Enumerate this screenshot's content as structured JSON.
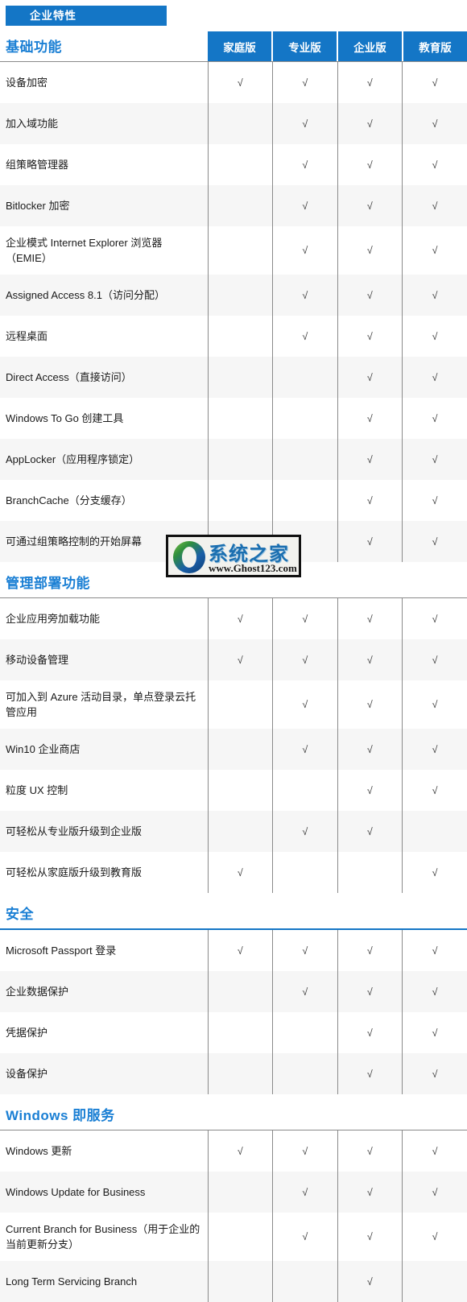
{
  "tab": {
    "label": "企业特性"
  },
  "columns": [
    "家庭版",
    "专业版",
    "企业版",
    "教育版"
  ],
  "check_glyph": "√",
  "colors": {
    "brand_blue": "#1476c6",
    "section_blue": "#1a7fd4",
    "rule_gray": "#8a8a8a",
    "alt_row": "#f6f6f6"
  },
  "watermark": {
    "name": "系统之家",
    "url": "www.Ghost123.com"
  },
  "sections": [
    {
      "title": "基础功能",
      "has_column_header": true,
      "rows": [
        {
          "name": "设备加密",
          "marks": [
            true,
            true,
            true,
            true
          ]
        },
        {
          "name": "加入域功能",
          "marks": [
            false,
            true,
            true,
            true
          ]
        },
        {
          "name": "组策略管理器",
          "marks": [
            false,
            true,
            true,
            true
          ]
        },
        {
          "name": "Bitlocker 加密",
          "marks": [
            false,
            true,
            true,
            true
          ]
        },
        {
          "name": "企业模式 Internet Explorer 浏览器（EMIE）",
          "marks": [
            false,
            true,
            true,
            true
          ],
          "tall": true
        },
        {
          "name": "Assigned Access 8.1（访问分配）",
          "marks": [
            false,
            true,
            true,
            true
          ]
        },
        {
          "name": "远程桌面",
          "marks": [
            false,
            true,
            true,
            true
          ]
        },
        {
          "name": "Direct Access（直接访问）",
          "marks": [
            false,
            false,
            true,
            true
          ]
        },
        {
          "name": "Windows To Go 创建工具",
          "marks": [
            false,
            false,
            true,
            true
          ]
        },
        {
          "name": "AppLocker（应用程序锁定）",
          "marks": [
            false,
            false,
            true,
            true
          ]
        },
        {
          "name": "BranchCache（分支缓存）",
          "marks": [
            false,
            false,
            true,
            true
          ]
        },
        {
          "name": "可通过组策略控制的开始屏幕",
          "marks": [
            false,
            false,
            true,
            true
          ]
        }
      ]
    },
    {
      "title": "管理部署功能",
      "has_column_header": false,
      "rows": [
        {
          "name": "企业应用旁加载功能",
          "marks": [
            true,
            true,
            true,
            true
          ]
        },
        {
          "name": "移动设备管理",
          "marks": [
            true,
            true,
            true,
            true
          ]
        },
        {
          "name": "可加入到 Azure 活动目录，单点登录云托管应用",
          "marks": [
            false,
            true,
            true,
            true
          ],
          "tall": true
        },
        {
          "name": "Win10 企业商店",
          "marks": [
            false,
            true,
            true,
            true
          ]
        },
        {
          "name": "粒度 UX 控制",
          "marks": [
            false,
            false,
            true,
            true
          ]
        },
        {
          "name": "可轻松从专业版升级到企业版",
          "marks": [
            false,
            true,
            true,
            false
          ]
        },
        {
          "name": "可轻松从家庭版升级到教育版",
          "marks": [
            true,
            false,
            false,
            true
          ]
        }
      ]
    },
    {
      "title": "安全",
      "has_column_header": false,
      "rows": [
        {
          "name": "Microsoft Passport 登录",
          "marks": [
            true,
            true,
            true,
            true
          ]
        },
        {
          "name": "企业数据保护",
          "marks": [
            false,
            true,
            true,
            true
          ]
        },
        {
          "name": "凭据保护",
          "marks": [
            false,
            false,
            true,
            true
          ]
        },
        {
          "name": "设备保护",
          "marks": [
            false,
            false,
            true,
            true
          ]
        }
      ]
    },
    {
      "title": "Windows 即服务",
      "has_column_header": false,
      "rows": [
        {
          "name": "Windows 更新",
          "marks": [
            true,
            true,
            true,
            true
          ]
        },
        {
          "name": "Windows Update for Business",
          "marks": [
            false,
            true,
            true,
            true
          ]
        },
        {
          "name": "Current Branch for Business（用于企业的当前更新分支）",
          "marks": [
            false,
            true,
            true,
            true
          ],
          "tall": true
        },
        {
          "name": "Long Term Servicing Branch",
          "marks": [
            false,
            false,
            true,
            false
          ]
        }
      ]
    }
  ]
}
